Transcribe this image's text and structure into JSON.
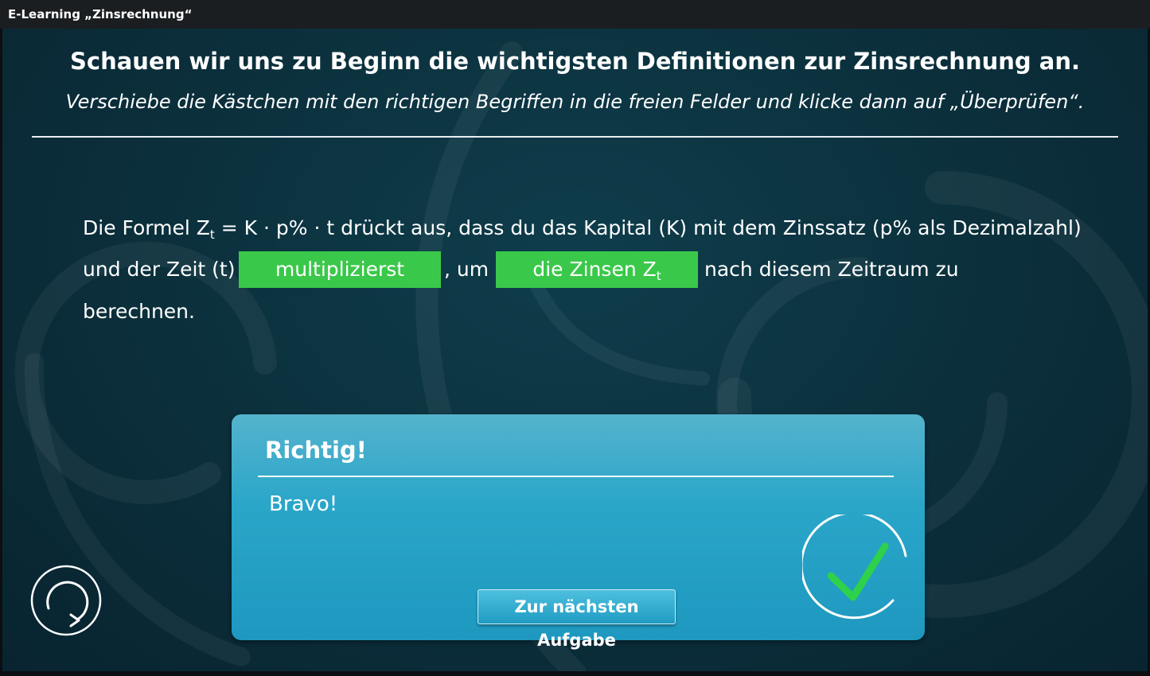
{
  "window": {
    "title": "E-Learning „Zinsrechnung“"
  },
  "task": {
    "heading": "Schauen wir uns zu Beginn die wichtigsten Definitionen zur Zinsrechnung an.",
    "instruction": "Verschiebe die Kästchen mit den richtigen Begriffen in die freien Felder und klicke dann auf „Überprüfen“."
  },
  "exercise": {
    "line1_prefix": "Die Formel Z",
    "line1_sub": "t",
    "line1_rest": " = K · p% · t drückt aus, dass du das Kapital (K) mit dem Zinssatz (p% als Dezimalzahl)",
    "line2_start": "und der Zeit (t)",
    "drop1": "multiplizierst",
    "between": ", um",
    "drop2_main": "die Zinsen Z",
    "drop2_sub": "t",
    "line2_end": "nach diesem Zeitraum zu",
    "line3": "berechnen."
  },
  "feedback": {
    "title": "Richtig!",
    "message": "Bravo!",
    "next_button": "Zur nächsten Aufgabe"
  },
  "icons": {
    "check": "check-circle-icon",
    "reset": "reset-icon"
  },
  "colors": {
    "stage_bg": "#0b2f3b",
    "drop_zone": "#3ac84a",
    "feedback_panel": "#2aa6c9",
    "check_mark": "#2ed14a"
  }
}
